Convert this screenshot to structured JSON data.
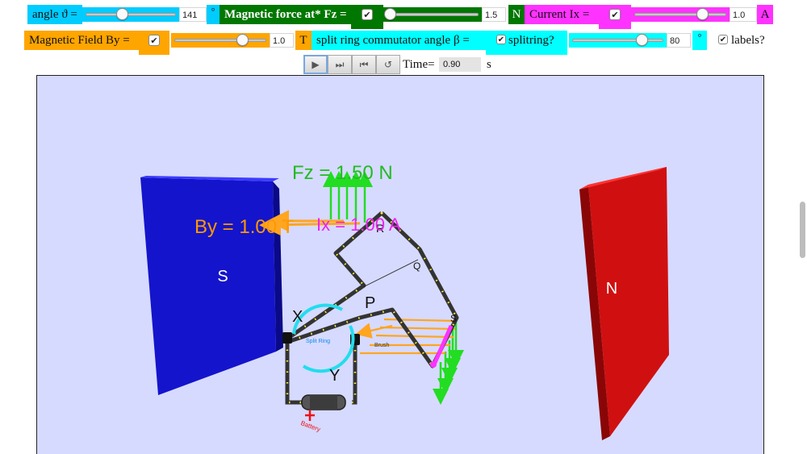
{
  "row1": {
    "angle_label": "angle ϑ =",
    "angle_value": "141",
    "angle_fraction": 0.39,
    "angle_unit": "°",
    "force_label": "Magnetic force at* Fz =",
    "force_checked": "✔",
    "force_value": "1.5",
    "force_fraction": 0.0,
    "force_unit": "N",
    "current_label": "Current Ix =",
    "current_checked": "✔",
    "current_value": "1.0",
    "current_fraction": 0.75,
    "current_unit": "A"
  },
  "row2": {
    "field_label": "Magnetic Field By =",
    "field_checked": "✔",
    "field_value": "1.0",
    "field_fraction": 0.75,
    "field_unit": "T",
    "ring_label": "split ring commutator angle β =",
    "splitring_checked": "✔",
    "splitring_label": "splitring?",
    "ring_value": "80",
    "ring_fraction": 0.78,
    "ring_unit": "°",
    "labels_checked": "✔",
    "labels_label": "labels?"
  },
  "controls": {
    "play_icon": "▶",
    "step_forward_icon": "⏭",
    "step_back_icon": "⏮",
    "reset_icon": "↺",
    "time_label": "Time=",
    "time_value": "0.90",
    "time_unit": "s"
  },
  "scene": {
    "fz_label": "Fz = 1.50 N",
    "by_label": "By = 1.00 T",
    "ix_label": "Ix = 1.00 A",
    "magnet_left_label": "S",
    "magnet_right_label": "N",
    "point_x": "X",
    "point_y": "Y",
    "point_p": "P",
    "point_q": "Q",
    "point_r": "R",
    "point_s": "S",
    "split_ring_label": "Split Ring",
    "brush_label": "Brush",
    "battery_label": "Battery",
    "colors": {
      "magnet_s": "#1010c8",
      "magnet_n": "#d01010",
      "force": "#22dd22",
      "field": "#ffa520",
      "current": "#ff33ff",
      "split_ring": "#22ddee",
      "background": "#d6daff"
    }
  }
}
